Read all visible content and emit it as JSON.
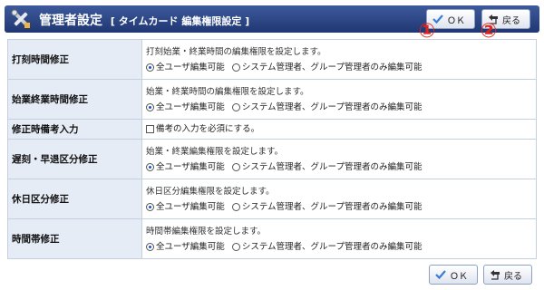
{
  "header": {
    "title": "管理者設定",
    "subtitle": "[ タイムカード 編集権限設定 ]",
    "ok_label": "ＯＫ",
    "back_label": "戻る"
  },
  "markers": [
    "①",
    "②"
  ],
  "rows": [
    {
      "label": "打刻時間修正",
      "desc": "打刻始業・終業時間の編集権限を設定します。",
      "opt1": "全ユーザ編集可能",
      "opt2": "システム管理者、グループ管理者のみ編集可能",
      "selected": 1
    },
    {
      "label": "始業終業時間修正",
      "desc": "始業・終業時間の編集権限を設定します。",
      "opt1": "全ユーザ編集可能",
      "opt2": "システム管理者、グループ管理者のみ編集可能",
      "selected": 1
    },
    {
      "label": "修正時備考入力",
      "checkbox": "備考の入力を必須にする。",
      "checked": false
    },
    {
      "label": "遅刻・早退区分修正",
      "desc": "始業・終業編集権限を設定します。",
      "opt1": "全ユーザ編集可能",
      "opt2": "システム管理者、グループ管理者のみ編集可能",
      "selected": 1
    },
    {
      "label": "休日区分修正",
      "desc": "休日区分編集権限を設定します。",
      "opt1": "全ユーザ編集可能",
      "opt2": "システム管理者、グループ管理者のみ編集可能",
      "selected": 1
    },
    {
      "label": "時間帯修正",
      "desc": "時間帯編集権限を設定します。",
      "opt1": "全ユーザ編集可能",
      "opt2": "システム管理者、グループ管理者のみ編集可能",
      "selected": 1
    }
  ],
  "footer": {
    "ok_label": "ＯＫ",
    "back_label": "戻る"
  },
  "colors": {
    "header_bg": "#2b4585",
    "label_bg": "#e6ecf6",
    "marker": "#e0241c",
    "ok_check": "#3a7bd5"
  }
}
